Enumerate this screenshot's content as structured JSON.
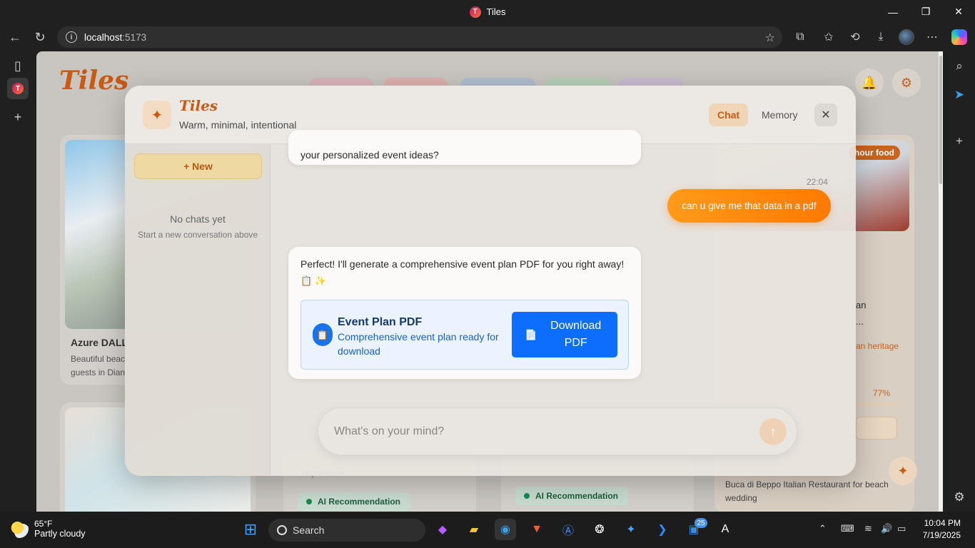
{
  "browser": {
    "title": "Tiles",
    "tab_logo": "T",
    "url_host": "localhost",
    "url_port": ":5173"
  },
  "page": {
    "brand": "Tiles",
    "bg_cards": [
      {
        "title": "Azure DALL-",
        "text1": "Beautiful beac",
        "text2": "guests in Dian"
      },
      {
        "tag": "hour food",
        "line1": "an",
        "line2": "...",
        "heritage": "an heritage",
        "percent": "77%",
        "footer": "Buca di Beppo Italian Restaurant for beach wedding"
      }
    ],
    "ai_badge": "AI Recommendation",
    "partial_label": "Importance"
  },
  "modal": {
    "brand": "Tiles",
    "subtitle": "Warm, minimal, intentional",
    "tab_chat": "Chat",
    "tab_memory": "Memory",
    "close": "✕",
    "new_button": "+ New",
    "empty_title": "No chats yet",
    "empty_sub": "Start a new conversation above"
  },
  "chat": {
    "prev_ai_tail": "your personalized event ideas?",
    "timestamp": "22:04",
    "user_msg": "can u give me that data in a pdf",
    "ai_msg": "Perfect! I'll generate a comprehensive event plan PDF for you right away!",
    "ai_emojis": "📋 ✨",
    "pdf_title": "Event Plan PDF",
    "pdf_desc": "Comprehensive event plan ready for download",
    "download_label": "Download PDF",
    "input_placeholder": "What's on your mind?"
  },
  "taskbar": {
    "temp": "65°F",
    "weather": "Partly cloudy",
    "search": "Search",
    "badge_count": "25",
    "time": "10:04 PM",
    "date": "7/19/2025"
  },
  "colors": {
    "brand": "#c85a14",
    "user_bubble": "#ff8a0a",
    "download": "#0d6efd"
  }
}
